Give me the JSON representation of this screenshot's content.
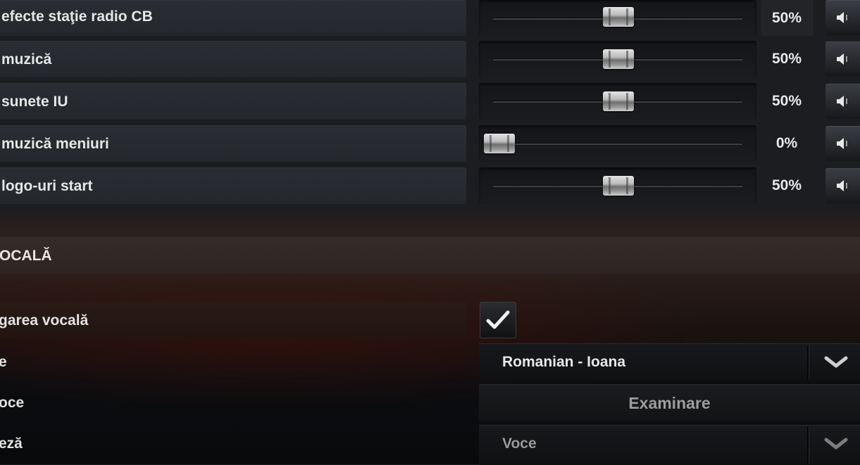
{
  "audio_rows": [
    {
      "label": "efecte staţie radio CB",
      "percent": 50,
      "percent_text": "50%"
    },
    {
      "label": "muzică",
      "percent": 50,
      "percent_text": "50%"
    },
    {
      "label": "sunete IU",
      "percent": 50,
      "percent_text": "50%"
    },
    {
      "label": "muzică meniuri",
      "percent": 0,
      "percent_text": "0%"
    },
    {
      "label": "logo-uri start",
      "percent": 50,
      "percent_text": "50%"
    }
  ],
  "section": {
    "title": "OCALĂ"
  },
  "voice_rows": {
    "enable_label": "garea vocală",
    "enable_checked": true,
    "voice_label": "e",
    "voice_value": "Romanian - Ioana",
    "preview_label": "oce",
    "preview_button": "Examinare",
    "mode_label": "eză",
    "mode_value": "Voce"
  },
  "colors": {
    "accent_dark_red": "#2e2421",
    "text": "#e8e8e8"
  },
  "icons": {
    "mute": "speaker-icon",
    "dropdown": "chevron-down-icon",
    "checkbox": "checkmark-icon"
  }
}
